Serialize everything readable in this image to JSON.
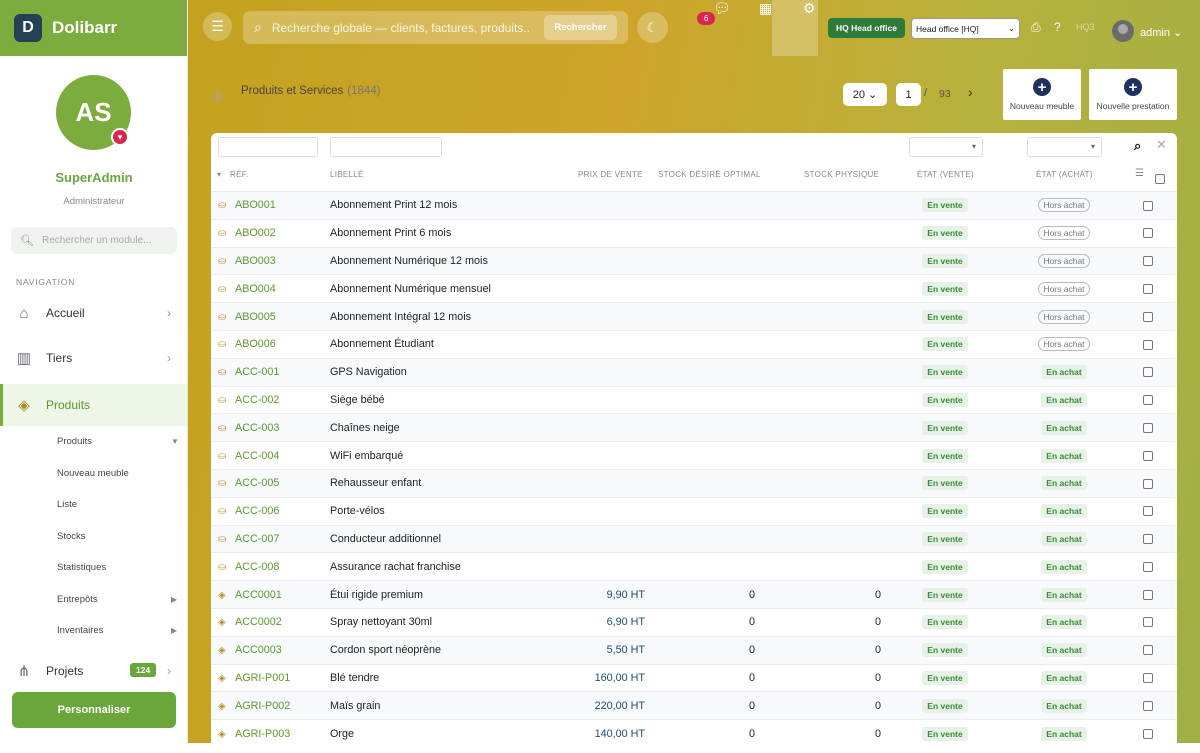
{
  "brand": {
    "logo": "D",
    "name": "Dolibarr"
  },
  "user": {
    "initials": "AS",
    "name": "SuperAdmin",
    "role": "Administrateur"
  },
  "sidebar": {
    "search_placeholder": "Rechercher un module...",
    "nav_title": "NAVIGATION",
    "items": [
      {
        "label": "Accueil",
        "icon": "home-icon"
      },
      {
        "label": "Tiers",
        "icon": "building-icon"
      },
      {
        "label": "Produits",
        "icon": "cube-icon"
      },
      {
        "label": "Projets",
        "icon": "sitemap-icon",
        "badge": "124"
      }
    ],
    "subitems": [
      "Produits",
      "Nouveau meuble",
      "Liste",
      "Stocks",
      "Statistiques",
      "Entrepôts",
      "Inventaires"
    ],
    "personalize": "Personnaliser"
  },
  "topbar": {
    "search_placeholder": "Recherche globale — clients, factures, produits...",
    "search_button": "Rechercher",
    "messages_badge": "6",
    "hq_badge": "HQ Head office",
    "entity_select": "Head office [HQ]",
    "faded_text": "HQ3",
    "admin": "admin"
  },
  "page": {
    "title": "Produits et Services",
    "count": "(1844)",
    "per_page": "20",
    "page_num": "1",
    "page_sep": "/",
    "page_total": "93",
    "btn_new_meuble": "Nouveau meuble",
    "btn_new_prestation": "Nouvelle prestation"
  },
  "table": {
    "headers": {
      "ref": "RÉF.",
      "libelle": "LIBELLÉ",
      "prix": "PRIX DE VENTE",
      "stock_desire": "STOCK DÉSIRÉ OPTIMAL",
      "stock_phys": "STOCK PHYSIQUE",
      "etat_vente": "ÉTAT (VENTE)",
      "etat_achat": "ÉTAT (ACHAT)"
    },
    "rows": [
      {
        "type": "service",
        "ref": "ABO001",
        "libelle": "Abonnement Print 12 mois",
        "prix": "",
        "stock": "",
        "phys": "",
        "vente": "En vente",
        "achat": "Hors achat"
      },
      {
        "type": "service",
        "ref": "ABO002",
        "libelle": "Abonnement Print 6 mois",
        "prix": "",
        "stock": "",
        "phys": "",
        "vente": "En vente",
        "achat": "Hors achat"
      },
      {
        "type": "service",
        "ref": "ABO003",
        "libelle": "Abonnement Numérique 12 mois",
        "prix": "",
        "stock": "",
        "phys": "",
        "vente": "En vente",
        "achat": "Hors achat"
      },
      {
        "type": "service",
        "ref": "ABO004",
        "libelle": "Abonnement Numérique mensuel",
        "prix": "",
        "stock": "",
        "phys": "",
        "vente": "En vente",
        "achat": "Hors achat"
      },
      {
        "type": "service",
        "ref": "ABO005",
        "libelle": "Abonnement Intégral 12 mois",
        "prix": "",
        "stock": "",
        "phys": "",
        "vente": "En vente",
        "achat": "Hors achat"
      },
      {
        "type": "service",
        "ref": "ABO006",
        "libelle": "Abonnement Étudiant",
        "prix": "",
        "stock": "",
        "phys": "",
        "vente": "En vente",
        "achat": "Hors achat"
      },
      {
        "type": "service",
        "ref": "ACC-001",
        "libelle": "GPS Navigation",
        "prix": "",
        "stock": "",
        "phys": "",
        "vente": "En vente",
        "achat": "En achat"
      },
      {
        "type": "service",
        "ref": "ACC-002",
        "libelle": "Siège bébé",
        "prix": "",
        "stock": "",
        "phys": "",
        "vente": "En vente",
        "achat": "En achat"
      },
      {
        "type": "service",
        "ref": "ACC-003",
        "libelle": "Chaînes neige",
        "prix": "",
        "stock": "",
        "phys": "",
        "vente": "En vente",
        "achat": "En achat"
      },
      {
        "type": "service",
        "ref": "ACC-004",
        "libelle": "WiFi embarqué",
        "prix": "",
        "stock": "",
        "phys": "",
        "vente": "En vente",
        "achat": "En achat"
      },
      {
        "type": "service",
        "ref": "ACC-005",
        "libelle": "Rehausseur enfant",
        "prix": "",
        "stock": "",
        "phys": "",
        "vente": "En vente",
        "achat": "En achat"
      },
      {
        "type": "service",
        "ref": "ACC-006",
        "libelle": "Porte-vélos",
        "prix": "",
        "stock": "",
        "phys": "",
        "vente": "En vente",
        "achat": "En achat"
      },
      {
        "type": "service",
        "ref": "ACC-007",
        "libelle": "Conducteur additionnel",
        "prix": "",
        "stock": "",
        "phys": "",
        "vente": "En vente",
        "achat": "En achat"
      },
      {
        "type": "service",
        "ref": "ACC-008",
        "libelle": "Assurance rachat franchise",
        "prix": "",
        "stock": "",
        "phys": "",
        "vente": "En vente",
        "achat": "En achat"
      },
      {
        "type": "product",
        "ref": "ACC0001",
        "libelle": "Étui rigide premium",
        "prix": "9,90 HT",
        "stock": "0",
        "phys": "0",
        "vente": "En vente",
        "achat": "En achat"
      },
      {
        "type": "product",
        "ref": "ACC0002",
        "libelle": "Spray nettoyant 30ml",
        "prix": "6,90 HT",
        "stock": "0",
        "phys": "0",
        "vente": "En vente",
        "achat": "En achat"
      },
      {
        "type": "product",
        "ref": "ACC0003",
        "libelle": "Cordon sport néoprène",
        "prix": "5,50 HT",
        "stock": "0",
        "phys": "0",
        "vente": "En vente",
        "achat": "En achat"
      },
      {
        "type": "product",
        "ref": "AGRI-P001",
        "libelle": "Blé tendre",
        "prix": "160,00 HT",
        "stock": "0",
        "phys": "0",
        "vente": "En vente",
        "achat": "En achat"
      },
      {
        "type": "product",
        "ref": "AGRI-P002",
        "libelle": "Maïs grain",
        "prix": "220,00 HT",
        "stock": "0",
        "phys": "0",
        "vente": "En vente",
        "achat": "En achat"
      },
      {
        "type": "product",
        "ref": "AGRI-P003",
        "libelle": "Orge",
        "prix": "140,00 HT",
        "stock": "0",
        "phys": "0",
        "vente": "En vente",
        "achat": "En achat"
      }
    ]
  },
  "colors": {
    "accent": "#7cab3e",
    "link": "#5a9a2b",
    "badge_red": "#d9264e",
    "navy": "#20305f"
  }
}
